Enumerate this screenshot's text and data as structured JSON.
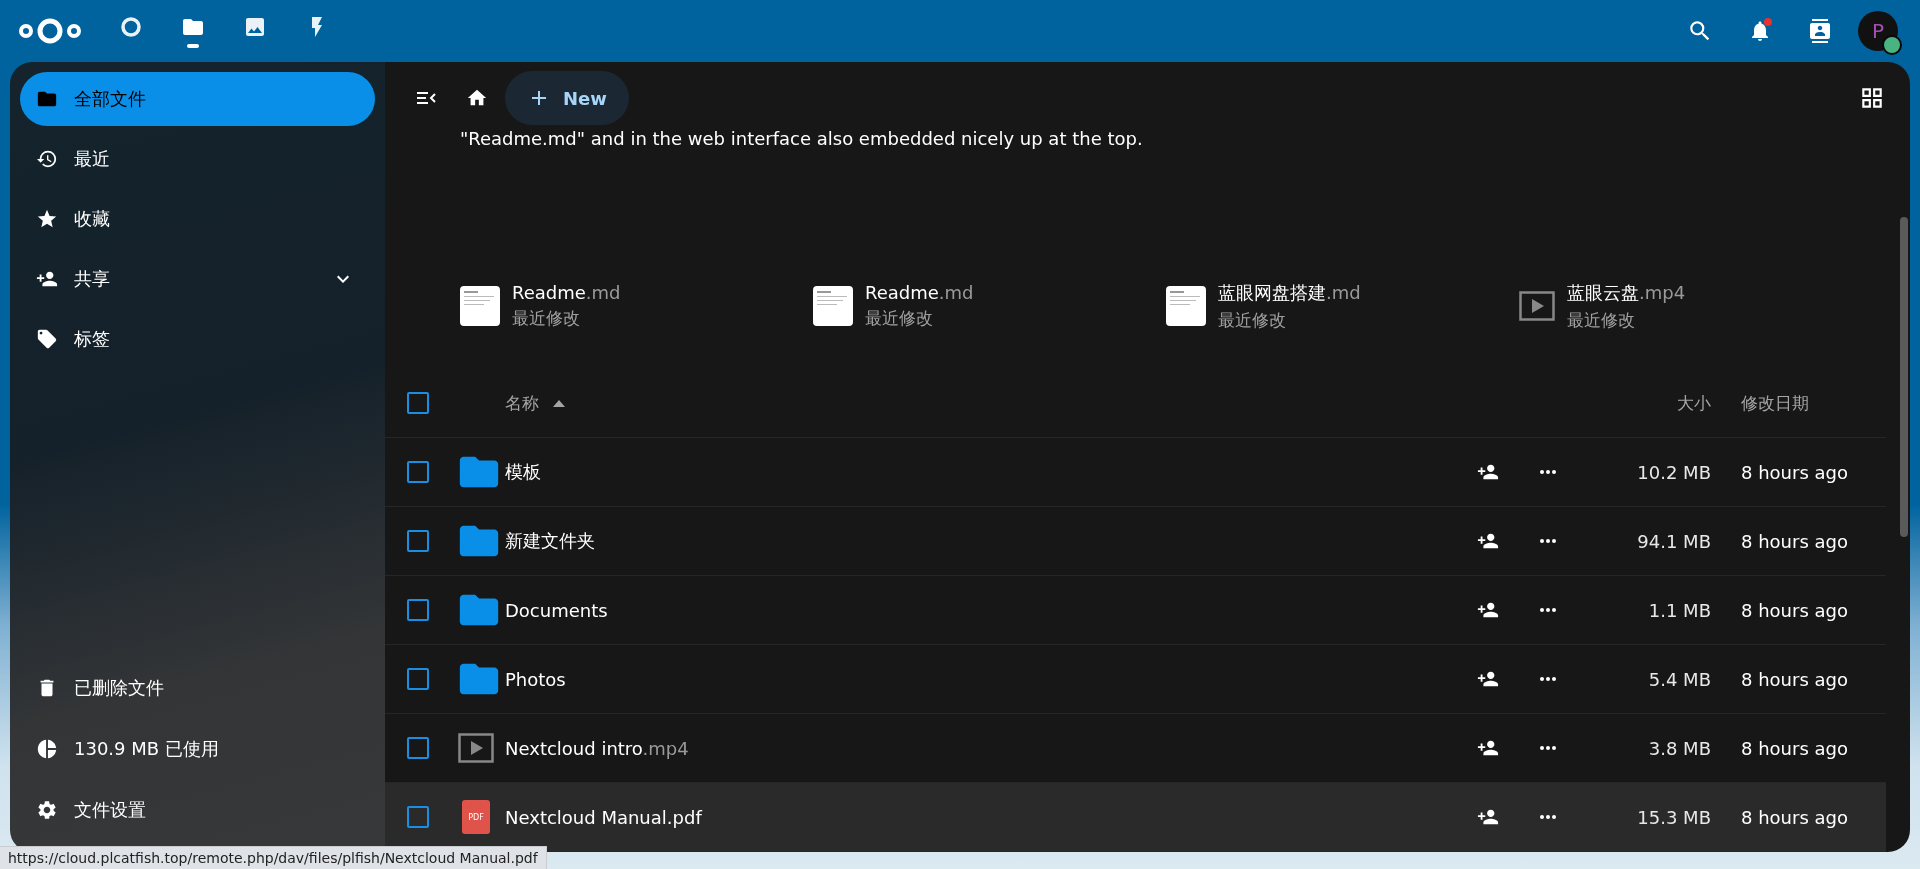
{
  "topbar": {
    "apps": [
      {
        "kind": "dashboard",
        "selected": false
      },
      {
        "kind": "files",
        "selected": true
      },
      {
        "kind": "photos",
        "selected": false
      },
      {
        "kind": "activity",
        "selected": false
      }
    ],
    "notifications_unread": true,
    "avatar": {
      "initial": "P",
      "online": true
    }
  },
  "sidebar": {
    "items": [
      {
        "kind": "folder",
        "label": "全部文件",
        "selected": true,
        "expandable": false
      },
      {
        "kind": "recent",
        "label": "最近",
        "selected": false,
        "expandable": false
      },
      {
        "kind": "favorites",
        "label": "收藏",
        "selected": false,
        "expandable": false
      },
      {
        "kind": "shared",
        "label": "共享",
        "selected": false,
        "expandable": true
      },
      {
        "kind": "tags",
        "label": "标签",
        "selected": false,
        "expandable": false
      }
    ],
    "footer": [
      {
        "kind": "trash",
        "label": "已删除文件"
      },
      {
        "kind": "quota",
        "label": "130.9 MB 已使用"
      },
      {
        "kind": "settings",
        "label": "文件设置"
      }
    ]
  },
  "toolbar": {
    "new_button": "New"
  },
  "readme": "\"Readme.md\" and in the web interface also embedded nicely up at the top.",
  "recent": [
    {
      "kind": "document",
      "name": "Readme",
      "extension": ".md",
      "caption": "最近修改"
    },
    {
      "kind": "document",
      "name": "Readme",
      "extension": ".md",
      "caption": "最近修改"
    },
    {
      "kind": "document",
      "name": "蓝眼网盘搭建",
      "extension": ".md",
      "caption": "最近修改"
    },
    {
      "kind": "video",
      "name": "蓝眼云盘",
      "extension": ".mp4",
      "caption": "最近修改"
    }
  ],
  "table": {
    "columns": {
      "name": "名称",
      "size": "大小",
      "modified": "修改日期"
    },
    "sort_ascending": true,
    "all_checked": false,
    "rows": [
      {
        "kind": "folder",
        "name": "模板",
        "size": "10.2 MB",
        "modified": "8 hours ago",
        "checked": false,
        "highlighted": false
      },
      {
        "kind": "folder",
        "name": "新建文件夹",
        "size": "94.1 MB",
        "modified": "8 hours ago",
        "checked": false,
        "highlighted": false
      },
      {
        "kind": "folder",
        "name": "Documents",
        "size": "1.1 MB",
        "modified": "8 hours ago",
        "checked": false,
        "highlighted": false
      },
      {
        "kind": "folder",
        "name": "Photos",
        "size": "5.4 MB",
        "modified": "8 hours ago",
        "checked": false,
        "highlighted": false
      },
      {
        "kind": "video",
        "name": "Nextcloud intro",
        "extension": ".mp4",
        "size": "3.8 MB",
        "modified": "8 hours ago",
        "checked": false,
        "highlighted": false
      },
      {
        "kind": "pdf",
        "icon_text": "PDF",
        "name": "Nextcloud Manual.pdf",
        "size": "15.3 MB",
        "modified": "8 hours ago",
        "checked": false,
        "highlighted": true
      }
    ]
  },
  "status_url": "https://cloud.plcatfish.top/remote.php/dav/files/plfish/Nextcloud Manual.pdf"
}
